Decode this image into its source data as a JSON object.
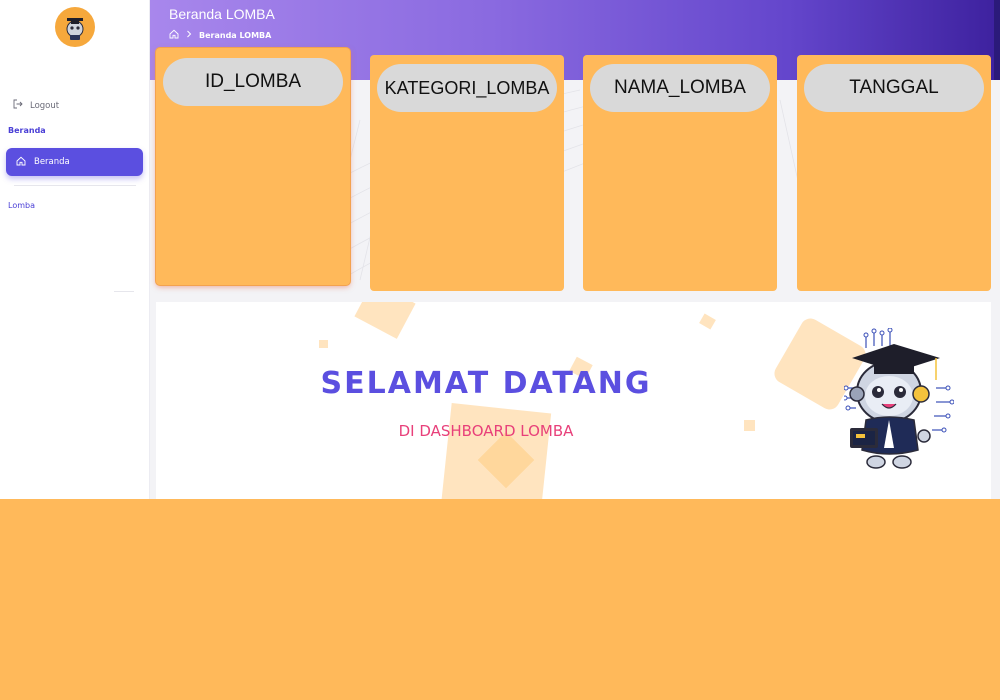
{
  "header": {
    "title": "Beranda LOMBA",
    "breadcrumb": "Beranda LOMBA"
  },
  "sidebar": {
    "logout_label": "Logout",
    "section_beranda": "Beranda",
    "nav_beranda_label": "Beranda",
    "section_lomba": "Lomba"
  },
  "cards": [
    {
      "label": "ID_LOMBA"
    },
    {
      "label": "KATEGORI_LOMBA"
    },
    {
      "label": "NAMA_LOMBA"
    },
    {
      "label": "TANGGAL"
    }
  ],
  "welcome": {
    "title": "SELAMAT DATANG",
    "subtitle": "DI DASHBOARD LOMBA"
  },
  "icons": {
    "logout": "logout-icon",
    "home": "home-icon",
    "chevron": "chevron-right-icon"
  },
  "colors": {
    "accent": "#5b4fe0",
    "card": "#ffb95a",
    "pill": "#d9d9d9",
    "subtitle": "#e8407a"
  }
}
